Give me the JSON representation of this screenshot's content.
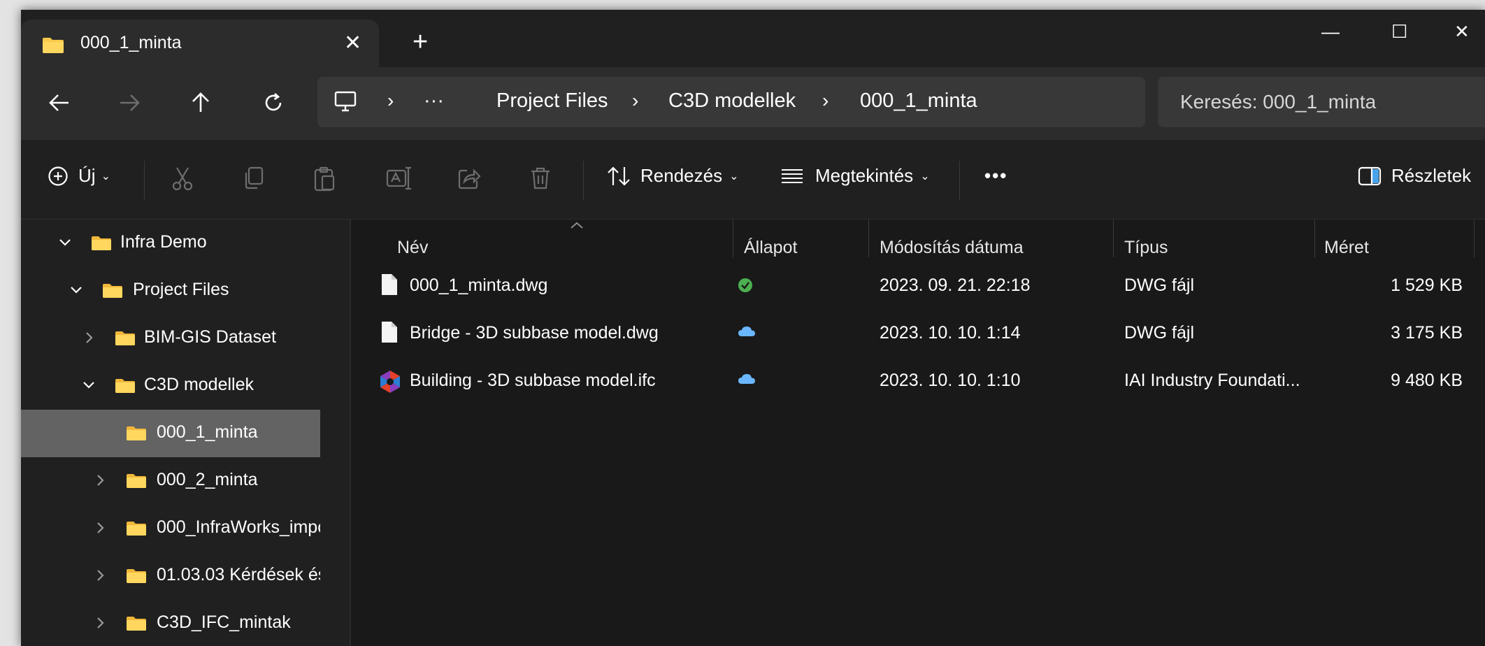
{
  "window": {
    "tab_title": "000_1_minta",
    "new_tab": "+",
    "close_tab": "✕",
    "minimize": "—",
    "maximize": "☐",
    "close": "✕"
  },
  "nav": {
    "back_icon": "arrow-left-icon",
    "forward_icon": "arrow-right-icon",
    "up_icon": "arrow-up-icon",
    "refresh_icon": "refresh-icon",
    "breadcrumb": {
      "more": "···",
      "items": [
        "Project Files",
        "C3D modellek",
        "000_1_minta"
      ]
    },
    "search_placeholder": "Keresés: 000_1_minta"
  },
  "toolbar": {
    "new_label": "Új",
    "sort_label": "Rendezés",
    "view_label": "Megtekintés",
    "more_label": "•••",
    "details_label": "Részletek"
  },
  "sidebar": {
    "items": [
      {
        "label": "Infra Demo",
        "expanded": true,
        "selected": false
      },
      {
        "label": "Project Files",
        "expanded": true,
        "selected": false
      },
      {
        "label": "BIM-GIS Dataset",
        "expanded": false,
        "selected": false
      },
      {
        "label": "C3D modellek",
        "expanded": true,
        "selected": false
      },
      {
        "label": "000_1_minta",
        "expanded": null,
        "selected": true
      },
      {
        "label": "000_2_minta",
        "expanded": false,
        "selected": false
      },
      {
        "label": "000_InfraWorks_impc",
        "expanded": false,
        "selected": false
      },
      {
        "label": "01.03.03 Kérdések és",
        "expanded": false,
        "selected": false
      },
      {
        "label": "C3D_IFC_mintak",
        "expanded": false,
        "selected": false
      }
    ]
  },
  "filelist": {
    "columns": {
      "name": "Név",
      "status": "Állapot",
      "modified": "Módosítás dátuma",
      "type": "Típus",
      "size": "Méret"
    },
    "rows": [
      {
        "name": "000_1_minta.dwg",
        "status": "synced",
        "modified": "2023. 09. 21. 22:18",
        "type": "DWG fájl",
        "size": "1 529 KB",
        "icon": "document-icon"
      },
      {
        "name": "Bridge - 3D subbase model.dwg",
        "status": "cloud",
        "modified": "2023. 10. 10. 1:14",
        "type": "DWG fájl",
        "size": "3 175 KB",
        "icon": "document-icon"
      },
      {
        "name": "Building - 3D subbase model.ifc",
        "status": "cloud",
        "modified": "2023. 10. 10. 1:10",
        "type": "IAI Industry Foundati...",
        "size": "9 480 KB",
        "icon": "ifc-file-icon"
      }
    ]
  },
  "colors": {
    "window_bg": "#202020",
    "tabbar_bg": "#2c2c2c",
    "list_bg": "#191919",
    "selected_bg": "#636363",
    "folder_yellow": "#f8c94a",
    "status_green": "#4caf50",
    "cloud_blue": "#6ab7ff"
  }
}
